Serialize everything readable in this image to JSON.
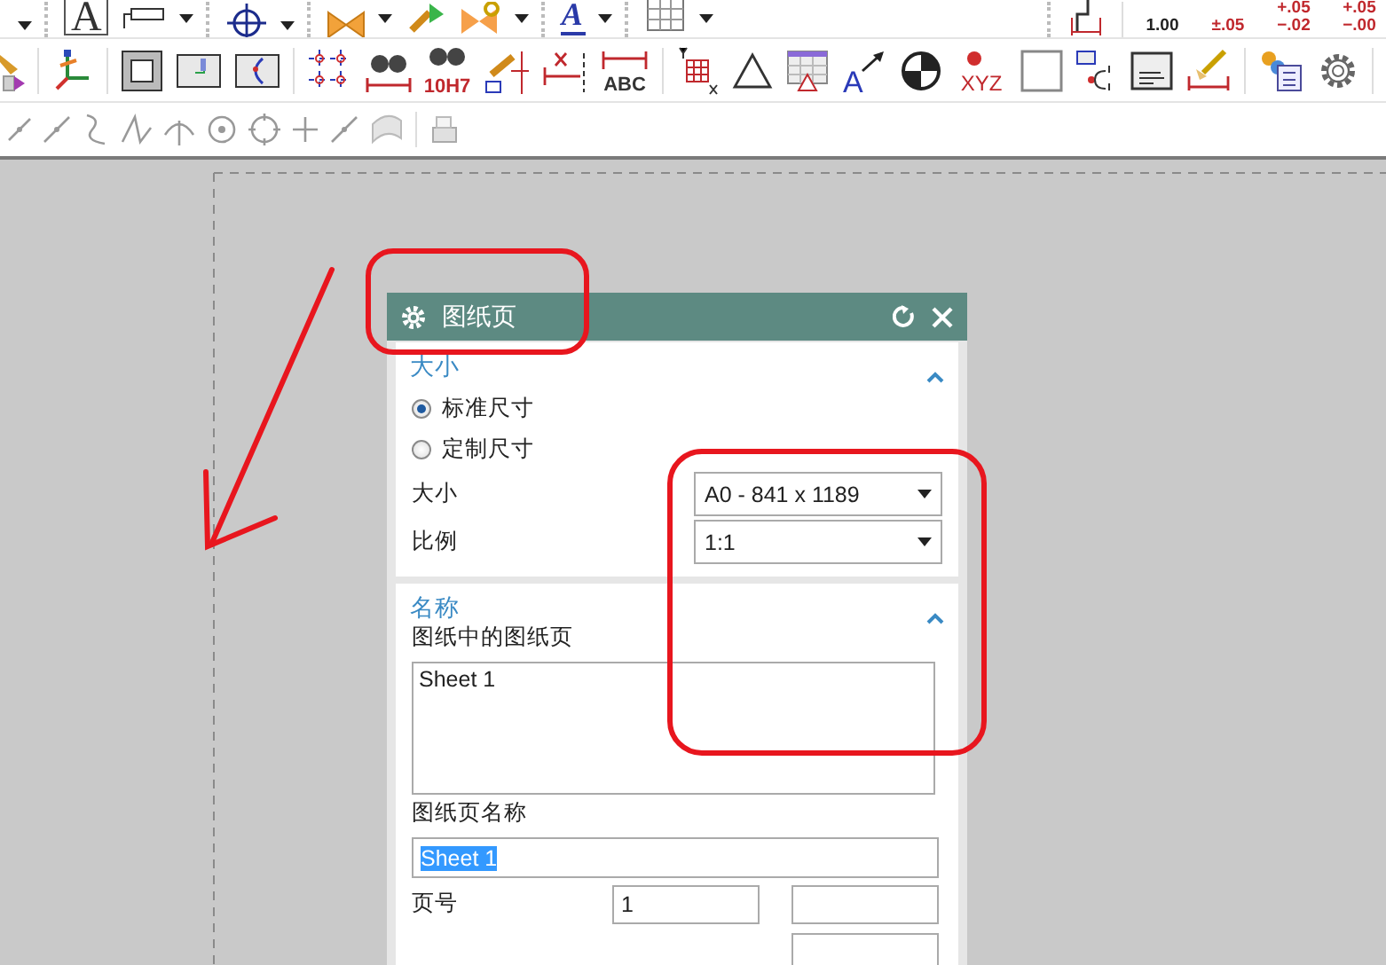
{
  "toolbar": {
    "letter_icons": [
      "A",
      "A",
      "A"
    ],
    "icon_labels": [
      "10H7",
      "ABC",
      "XYZ"
    ],
    "tolerance_icons": [
      {
        "kind": "nominal",
        "lines": [
          "1.00"
        ]
      },
      {
        "kind": "tolerance",
        "lines": [
          "±.05"
        ]
      },
      {
        "kind": "tolerance",
        "lines": [
          "+.05",
          "−.02"
        ]
      },
      {
        "kind": "tolerance",
        "lines": [
          "+.05",
          "−.00"
        ]
      }
    ]
  },
  "dialog": {
    "title": "图纸页",
    "sections": [
      {
        "kind": "size",
        "title": "大小",
        "expanded": true,
        "radios": [
          {
            "label": "标准尺寸",
            "selected": true
          },
          {
            "label": "定制尺寸",
            "selected": false
          }
        ],
        "dropdowns": [
          {
            "label": "大小",
            "value": "A0 - 841 x 1189"
          },
          {
            "label": "比例",
            "value": "1:1"
          }
        ]
      },
      {
        "kind": "name",
        "title": "名称",
        "expanded": true,
        "list_label": "图纸中的图纸页",
        "list_items": [
          {
            "label": "Sheet 1",
            "selected": false
          }
        ],
        "name_label": "图纸页名称",
        "name_value": "Sheet 1",
        "page_number_label": "页号",
        "page_number": "1"
      }
    ]
  }
}
